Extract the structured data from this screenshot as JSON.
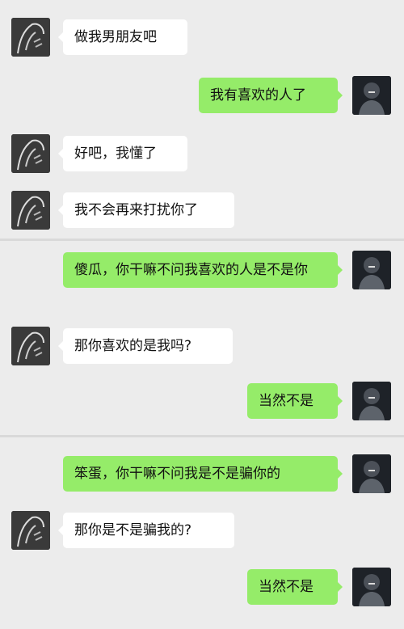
{
  "chat": {
    "messages": [
      {
        "side": "left",
        "text": "做我男朋友吧"
      },
      {
        "side": "right",
        "text": "我有喜欢的人了"
      },
      {
        "side": "left",
        "text": "好吧，我懂了"
      },
      {
        "side": "left",
        "text": "我不会再来打扰你了"
      },
      {
        "side": "right",
        "text": "傻瓜，你干嘛不问我喜欢的人是不是你"
      },
      {
        "side": "left",
        "text": "那你喜欢的是我吗?"
      },
      {
        "side": "right",
        "text": "当然不是"
      },
      {
        "side": "right",
        "text": "笨蛋，你干嘛不问我是不是骗你的"
      },
      {
        "side": "left",
        "text": "那你是不是骗我的?"
      },
      {
        "side": "right",
        "text": "当然不是"
      }
    ]
  },
  "avatars": {
    "left_icon": "sketch-face-avatar-icon",
    "right_icon": "dark-portrait-avatar-icon"
  },
  "colors": {
    "background": "#ececec",
    "incoming_bubble": "#ffffff",
    "outgoing_bubble": "#95ec69",
    "text": "#111111"
  }
}
